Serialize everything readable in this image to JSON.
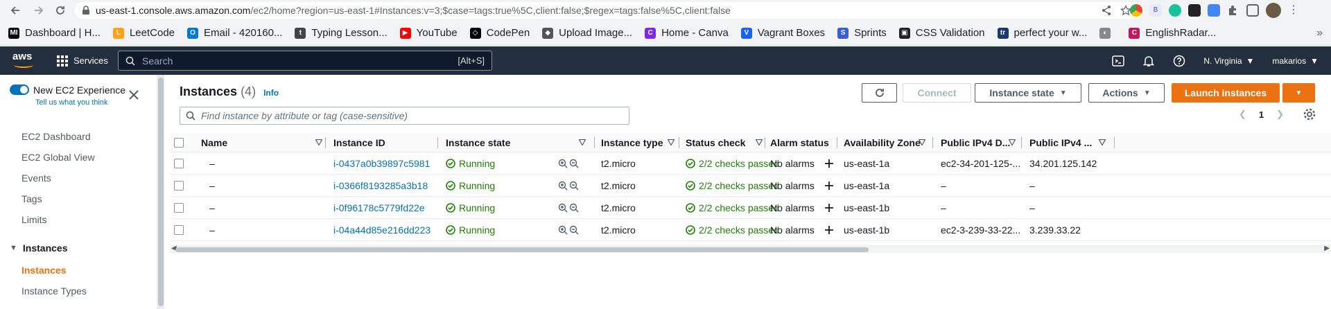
{
  "browser": {
    "url_host": "us-east-1.console.aws.amazon.com",
    "url_path": "/ec2/home?region=us-east-1#Instances:v=3;$case=tags:true%5C,client:false;$regex=tags:false%5C,client:false",
    "bookmarks": [
      {
        "label": "Dashboard | H...",
        "color": "#000000",
        "glyph": "MI"
      },
      {
        "label": "LeetCode",
        "color": "#ffa116",
        "glyph": "L"
      },
      {
        "label": "Email - 420160...",
        "color": "#0078d4",
        "glyph": "O"
      },
      {
        "label": "Typing Lesson...",
        "color": "#444444",
        "glyph": "t"
      },
      {
        "label": "YouTube",
        "color": "#ff0000",
        "glyph": "▶"
      },
      {
        "label": "CodePen",
        "color": "#000000",
        "glyph": "◇"
      },
      {
        "label": "Upload Image...",
        "color": "#555555",
        "glyph": "◆"
      },
      {
        "label": "Home - Canva",
        "color": "#7d2ae8",
        "glyph": "C"
      },
      {
        "label": "Vagrant Boxes",
        "color": "#1563ff",
        "glyph": "V"
      },
      {
        "label": "Sprints",
        "color": "#3b5bdb",
        "glyph": "S"
      },
      {
        "label": "CSS Validation",
        "color": "#222222",
        "glyph": "▣"
      },
      {
        "label": "perfect your w...",
        "color": "#1a3a6e",
        "glyph": "tr"
      },
      {
        "label": "",
        "color": "#888888",
        "glyph": "◐"
      },
      {
        "label": "EnglishRadar...",
        "color": "#c2185b",
        "glyph": "C"
      }
    ]
  },
  "aws": {
    "logo": "aws",
    "services_label": "Services",
    "search_placeholder": "Search",
    "search_shortcut": "[Alt+S]",
    "region": "N. Virginia",
    "user": "makarios"
  },
  "sidebar": {
    "experience_title": "New EC2 Experience",
    "experience_link": "Tell us what you think",
    "items": [
      "EC2 Dashboard",
      "EC2 Global View",
      "Events",
      "Tags",
      "Limits"
    ],
    "section_title": "Instances",
    "section_items": [
      "Instances",
      "Instance Types"
    ]
  },
  "main": {
    "title": "Instances",
    "count": "(4)",
    "info": "Info",
    "buttons": {
      "connect": "Connect",
      "instance_state": "Instance state",
      "actions": "Actions",
      "launch": "Launch instances"
    },
    "find_placeholder": "Find instance by attribute or tag (case-sensitive)",
    "page": "1"
  },
  "table": {
    "columns": [
      "Name",
      "Instance ID",
      "Instance state",
      "Instance type",
      "Status check",
      "Alarm status",
      "Availability Zone",
      "Public IPv4 D...",
      "Public IPv4 ..."
    ],
    "rows": [
      {
        "name": "–",
        "id": "i-0437a0b39897c5981",
        "state": "Running",
        "type": "t2.micro",
        "status": "2/2 checks passed",
        "alarm": "No alarms",
        "az": "us-east-1a",
        "dns": "ec2-34-201-125-...",
        "ip": "34.201.125.142"
      },
      {
        "name": "–",
        "id": "i-0366f8193285a3b18",
        "state": "Running",
        "type": "t2.micro",
        "status": "2/2 checks passed",
        "alarm": "No alarms",
        "az": "us-east-1a",
        "dns": "–",
        "ip": "–"
      },
      {
        "name": "–",
        "id": "i-0f96178c5779fd22e",
        "state": "Running",
        "type": "t2.micro",
        "status": "2/2 checks passed",
        "alarm": "No alarms",
        "az": "us-east-1b",
        "dns": "–",
        "ip": "–"
      },
      {
        "name": "–",
        "id": "i-04a44d85e216dd223",
        "state": "Running",
        "type": "t2.micro",
        "status": "2/2 checks passed",
        "alarm": "No alarms",
        "az": "us-east-1b",
        "dns": "ec2-3-239-33-22...",
        "ip": "3.239.33.22"
      }
    ]
  }
}
